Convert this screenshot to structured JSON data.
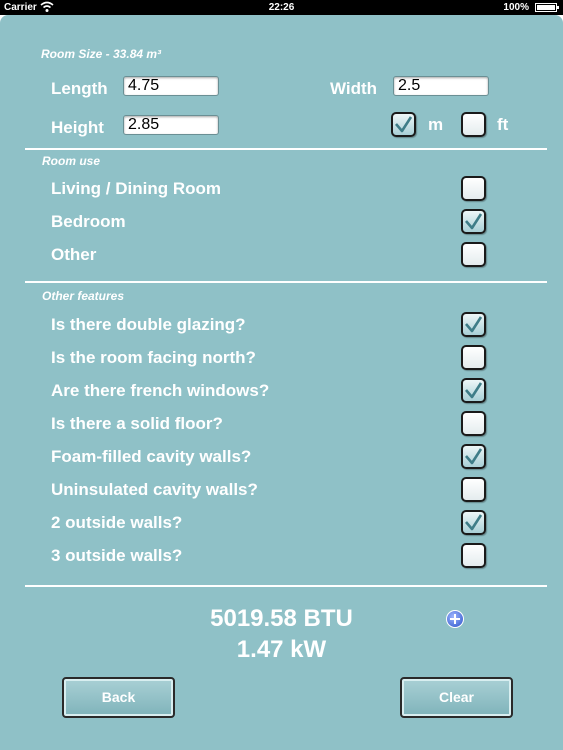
{
  "status_bar": {
    "carrier": "Carrier",
    "time": "22:26",
    "battery": "100%",
    "battery_level": 1.0
  },
  "room_size": {
    "label": "Room Size - 33.84 m³"
  },
  "dimensions": {
    "length_label": "Length",
    "length_value": "4.75",
    "width_label": "Width",
    "width_value": "2.5",
    "height_label": "Height",
    "height_value": "2.85"
  },
  "units": {
    "m_label": "m",
    "m_checked": true,
    "ft_label": "ft",
    "ft_checked": false
  },
  "room_use": {
    "title": "Room use",
    "items": [
      {
        "label": "Living / Dining Room",
        "checked": false
      },
      {
        "label": "Bedroom",
        "checked": true
      },
      {
        "label": "Other",
        "checked": false
      }
    ]
  },
  "other_features": {
    "title": "Other features",
    "items": [
      {
        "label": "Is there double glazing?",
        "checked": true
      },
      {
        "label": "Is the room facing north?",
        "checked": false
      },
      {
        "label": "Are there french windows?",
        "checked": true
      },
      {
        "label": "Is there a solid floor?",
        "checked": false
      },
      {
        "label": "Foam-filled cavity walls?",
        "checked": true
      },
      {
        "label": "Uninsulated cavity walls?",
        "checked": false
      },
      {
        "label": "2 outside walls?",
        "checked": true
      },
      {
        "label": "3 outside walls?",
        "checked": false
      }
    ]
  },
  "result": {
    "btu": "5019.58 BTU",
    "kw": "1.47 kW"
  },
  "buttons": {
    "back": "Back",
    "clear": "Clear"
  },
  "colors": {
    "panel": "#8fc1c7",
    "text": "#ffffff"
  },
  "icons": [
    "wifi-icon",
    "battery-icon",
    "checkmark-icon",
    "info-plus-icon"
  ]
}
